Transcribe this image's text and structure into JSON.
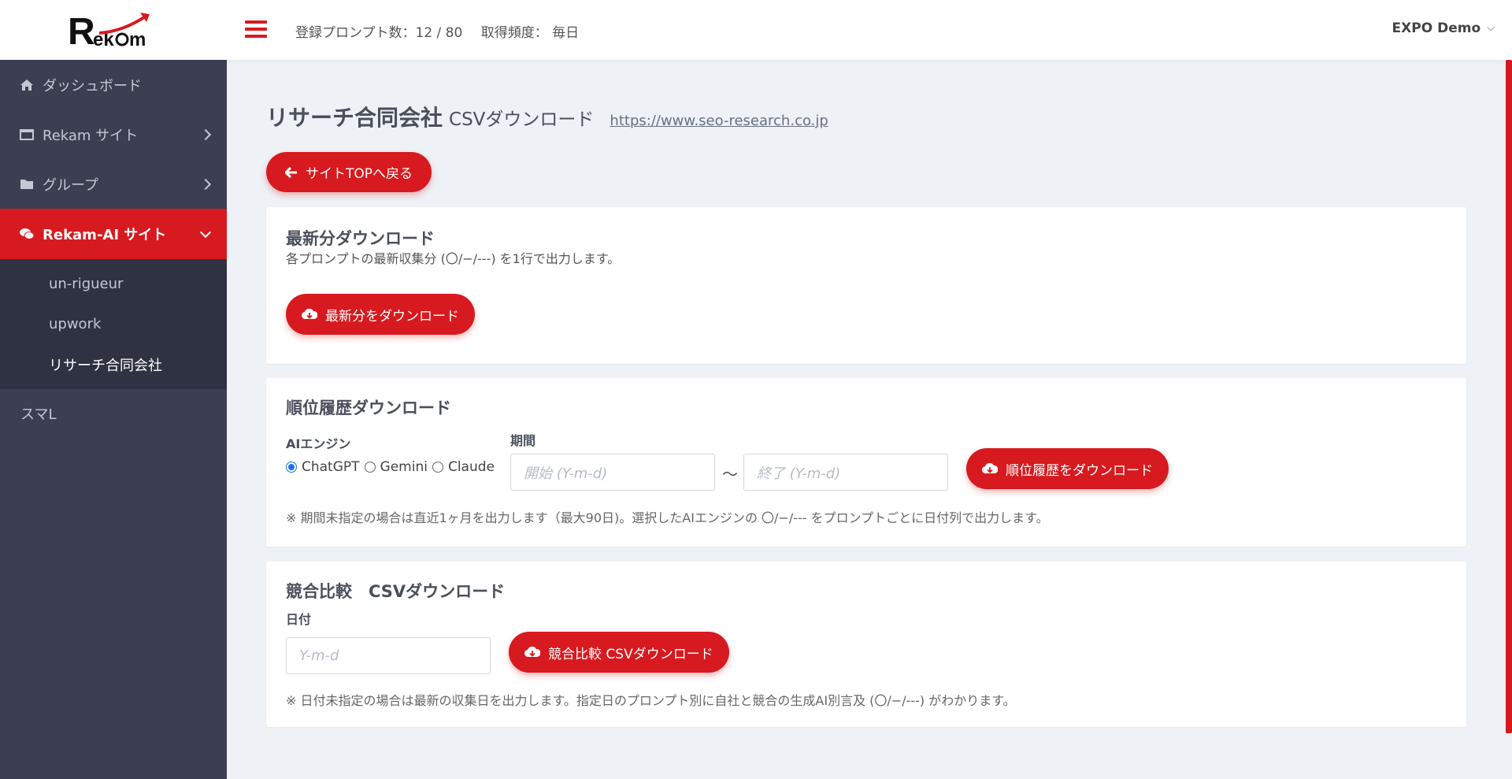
{
  "header": {
    "prompt_count_label": "登録プロンプト数：",
    "prompt_count_value": "12 / 80",
    "frequency_label": "取得頻度：",
    "frequency_value": "毎日",
    "user": "EXPO Demo"
  },
  "sidebar": {
    "items": [
      {
        "label": "ダッシュボード",
        "icon": "home-icon"
      },
      {
        "label": "Rekam サイト",
        "icon": "monitor-icon"
      },
      {
        "label": "グループ",
        "icon": "folder-icon"
      },
      {
        "label": "Rekam-AI サイト",
        "icon": "chat-icon"
      }
    ],
    "subitems": [
      "un-rigueur",
      "upwork",
      "リサーチ合同会社"
    ],
    "last_item": "スマL"
  },
  "page": {
    "title": "リサーチ合同会社",
    "subtitle": "CSVダウンロード",
    "url": "https://www.seo-research.co.jp",
    "back_button": "サイトTOPへ戻る"
  },
  "latest": {
    "title": "最新分ダウンロード",
    "desc": "各プロンプトの最新収集分 (〇/−/---) を1行で出力します。",
    "button": "最新分をダウンロード"
  },
  "history": {
    "title": "順位履歴ダウンロード",
    "engine_label": "AIエンジン",
    "period_label": "期間",
    "engines": [
      "ChatGPT",
      "Gemini",
      "Claude"
    ],
    "selected_engine": "ChatGPT",
    "start_placeholder": "開始 (Y-m-d)",
    "tilde": "〜",
    "end_placeholder": "終了 (Y-m-d)",
    "button": "順位履歴をダウンロード",
    "note": "※ 期間未指定の場合は直近1ヶ月を出力します（最大90日)。選択したAIエンジンの 〇/−/--- をプロンプトごとに日付列で出力します。"
  },
  "compare": {
    "title": "競合比較　CSVダウンロード",
    "date_label": "日付",
    "date_placeholder": "Y-m-d",
    "button": "競合比較 CSVダウンロード",
    "note": "※ 日付未指定の場合は最新の収集日を出力します。指定日のプロンプト別に自社と競合の生成AI別言及 (〇/−/---) がわかります。"
  },
  "colors": {
    "brand_red": "#d71a1f",
    "sidebar_bg": "#3b3f51",
    "submenu_bg": "#2f3242"
  }
}
